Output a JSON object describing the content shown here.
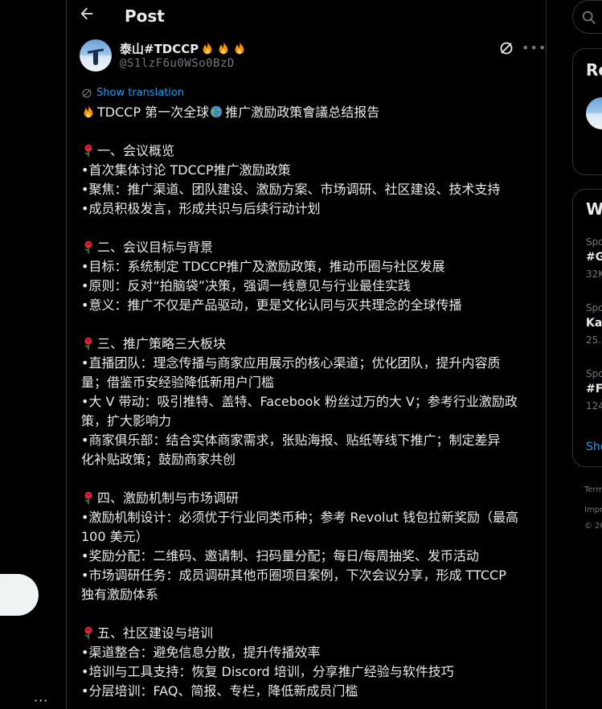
{
  "left_nav": {
    "more_label": "···"
  },
  "header": {
    "title": "Post"
  },
  "post": {
    "author_name": "泰山#TDCCP",
    "author_handle": "@S1lzF6u0WSo0BzD",
    "translate_label": "Show translation",
    "lines": [
      {
        "emoji": "fire",
        "text": "TDCCP 第一次全球"
      },
      {
        "text": ""
      },
      {
        "emoji": "rose",
        "text": "一、会议概览"
      },
      {
        "text": "•首次集体讨论 TDCCP推广激励政策"
      },
      {
        "text": "•聚焦：推广渠道、团队建设、激励方案、市场调研、社区建设、技术支持"
      },
      {
        "text": "•成员积极发言，形成共识与后续行动计划"
      },
      {
        "text": ""
      },
      {
        "emoji": "rose",
        "text": "二、会议目标与背景"
      },
      {
        "text": "•目标：系统制定 TDCCP推广及激励政策，推动币圈与社区发展"
      },
      {
        "text": "•原则：反对“拍脑袋”决策，强调一线意见与行业最佳实践"
      },
      {
        "text": "•意义：推广不仅是产品驱动，更是文化认同与灭共理念的全球传播"
      },
      {
        "text": ""
      },
      {
        "emoji": "rose",
        "text": "三、推广策略三大板块"
      },
      {
        "text": "•直播团队：理念传播与商家应用展示的核心渠道；优化团队，提升内容质"
      },
      {
        "text": "量；借鉴币安经验降低新用户门槛"
      },
      {
        "text": "•大 V 带动：吸引推特、盖特、Facebook 粉丝过万的大 V；参考行业激励政"
      },
      {
        "text": "策，扩大影响力"
      },
      {
        "text": "•商家俱乐部：结合实体商家需求，张贴海报、贴纸等线下推广；制定差异"
      },
      {
        "text": "化补贴政策；鼓励商家共创"
      },
      {
        "text": ""
      },
      {
        "emoji": "rose",
        "text": "四、激励机制与市场调研"
      },
      {
        "text": "•激励机制设计：必须优于行业同类币种；参考 Revolut 钱包拉新奖励（最高"
      },
      {
        "text": "100 美元）"
      },
      {
        "text": "•奖励分配：二维码、邀请制、扫码量分配；每日/每周抽奖、发币活动"
      },
      {
        "text": "•市场调研任务：成员调研其他币圈项目案例，下次会议分享，形成 TTCCP"
      },
      {
        "text": "独有激励体系"
      },
      {
        "text": ""
      },
      {
        "emoji": "rose",
        "text": "五、社区建设与培训"
      },
      {
        "text": "•渠道整合：避免信息分散，提升传播效率"
      },
      {
        "text": "•培训与工具支持：恢复 Discord 培训，分享推广经验与软件技巧"
      },
      {
        "text": "•分层培训：FAQ、简报、专栏，降低新成员门槛"
      }
    ],
    "first_line_tail": "推广激励政策會議总结报告"
  },
  "right": {
    "card1_title": "Re",
    "card2_title": "W",
    "trends": [
      {
        "cat": "Spo",
        "name": "#G",
        "count": "32K"
      },
      {
        "cat": "Spo",
        "name": "Ka",
        "count": "25."
      },
      {
        "cat": "Spo",
        "name": "#F",
        "count": "124"
      }
    ],
    "show_more": "Sho",
    "footer": [
      "Term",
      "Impr",
      "© 20"
    ]
  },
  "colors": {
    "accent": "#1d9bf0",
    "text": "#e7e9ea",
    "muted": "#71767b",
    "border": "#2f3336"
  }
}
